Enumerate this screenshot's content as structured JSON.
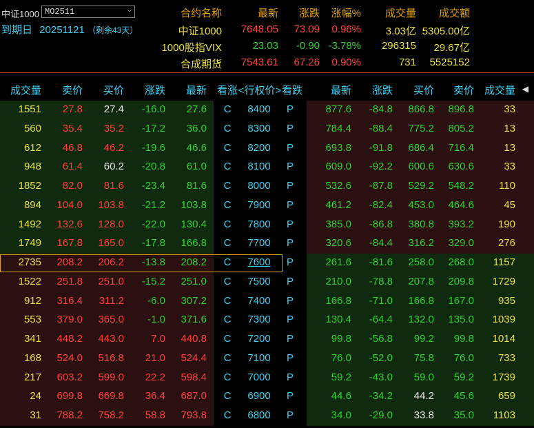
{
  "header": {
    "instrument_label": "中证1000",
    "contract_select": "MO2511",
    "expiry_label": "到期日",
    "expiry_date": "20251121",
    "expiry_remaining": "（剩余43天）",
    "columns": [
      "合约名称",
      "最新",
      "涨跌",
      "涨幅%",
      "成交量",
      "成交额"
    ],
    "indices": [
      {
        "name": "中证1000",
        "last": "7648.05",
        "chg": "73.09",
        "pct": "0.96%",
        "vol": "3.03亿",
        "amt": "5305.00亿"
      },
      {
        "name": "1000股指VIX",
        "last": "23.03",
        "chg": "-0.90",
        "pct": "-3.78%",
        "vol": "296315",
        "amt": "29.67亿"
      },
      {
        "name": "合成期货",
        "last": "7543.61",
        "chg": "67.26",
        "pct": "0.90%",
        "vol": "731",
        "amt": "5525152"
      }
    ]
  },
  "table": {
    "columns": [
      "成交量",
      "卖价",
      "买价",
      "涨跌",
      "最新",
      "看涨",
      "<行权价>",
      "看跌",
      "最新",
      "涨跌",
      "买价",
      "卖价",
      "成交量"
    ],
    "rows": [
      {
        "cv": "1551",
        "cs": "27.8",
        "cb": "27.4",
        "cc": "-16.0",
        "cl": "27.6",
        "k": "8400",
        "pl": "877.6",
        "pc": "-84.8",
        "pb": "866.8",
        "ps": "896.8",
        "pv": "33"
      },
      {
        "cv": "560",
        "cs": "35.4",
        "cb": "35.2",
        "cc": "-17.2",
        "cl": "36.0",
        "k": "8300",
        "pl": "784.4",
        "pc": "-88.4",
        "pb": "775.2",
        "ps": "805.2",
        "pv": "13"
      },
      {
        "cv": "612",
        "cs": "46.8",
        "cb": "46.2",
        "cc": "-19.6",
        "cl": "46.6",
        "k": "8200",
        "pl": "693.8",
        "pc": "-91.8",
        "pb": "686.4",
        "ps": "716.4",
        "pv": "13"
      },
      {
        "cv": "948",
        "cs": "61.4",
        "cb": "60.2",
        "cc": "-20.8",
        "cl": "61.0",
        "k": "8100",
        "pl": "609.0",
        "pc": "-92.2",
        "pb": "600.6",
        "ps": "630.6",
        "pv": "33"
      },
      {
        "cv": "1852",
        "cs": "82.0",
        "cb": "81.6",
        "cc": "-23.4",
        "cl": "81.6",
        "k": "8000",
        "pl": "532.6",
        "pc": "-87.8",
        "pb": "529.2",
        "ps": "548.2",
        "pv": "110"
      },
      {
        "cv": "894",
        "cs": "104.0",
        "cb": "103.8",
        "cc": "-21.2",
        "cl": "103.8",
        "k": "7900",
        "pl": "461.2",
        "pc": "-82.4",
        "pb": "453.0",
        "ps": "464.6",
        "pv": "45"
      },
      {
        "cv": "1492",
        "cs": "132.6",
        "cb": "128.0",
        "cc": "-22.0",
        "cl": "130.4",
        "k": "7800",
        "pl": "385.0",
        "pc": "-86.8",
        "pb": "380.8",
        "ps": "393.2",
        "pv": "190"
      },
      {
        "cv": "1749",
        "cs": "167.8",
        "cb": "165.0",
        "cc": "-17.8",
        "cl": "166.8",
        "k": "7700",
        "pl": "320.6",
        "pc": "-84.4",
        "pb": "316.2",
        "ps": "329.0",
        "pv": "276"
      },
      {
        "cv": "2735",
        "cs": "208.2",
        "cb": "206.2",
        "cc": "-13.8",
        "cl": "208.2",
        "k": "7600",
        "pl": "261.6",
        "pc": "-81.6",
        "pb": "258.0",
        "ps": "268.0",
        "pv": "1157"
      },
      {
        "cv": "1522",
        "cs": "251.8",
        "cb": "251.0",
        "cc": "-15.2",
        "cl": "251.0",
        "k": "7500",
        "pl": "210.0",
        "pc": "-78.8",
        "pb": "207.8",
        "ps": "209.8",
        "pv": "1729"
      },
      {
        "cv": "912",
        "cs": "316.4",
        "cb": "311.2",
        "cc": "-6.0",
        "cl": "307.2",
        "k": "7400",
        "pl": "166.8",
        "pc": "-71.0",
        "pb": "166.8",
        "ps": "167.0",
        "pv": "935"
      },
      {
        "cv": "553",
        "cs": "379.0",
        "cb": "365.0",
        "cc": "-1.0",
        "cl": "371.6",
        "k": "7300",
        "pl": "130.4",
        "pc": "-64.4",
        "pb": "132.0",
        "ps": "135.0",
        "pv": "1039"
      },
      {
        "cv": "341",
        "cs": "448.2",
        "cb": "443.0",
        "cc": "7.0",
        "cl": "440.8",
        "k": "7200",
        "pl": "99.8",
        "pc": "-56.8",
        "pb": "99.2",
        "ps": "99.8",
        "pv": "1014"
      },
      {
        "cv": "168",
        "cs": "524.0",
        "cb": "516.8",
        "cc": "21.0",
        "cl": "524.4",
        "k": "7100",
        "pl": "76.0",
        "pc": "-52.0",
        "pb": "75.8",
        "ps": "76.0",
        "pv": "733"
      },
      {
        "cv": "217",
        "cs": "603.2",
        "cb": "599.0",
        "cc": "22.2",
        "cl": "598.4",
        "k": "7000",
        "pl": "59.2",
        "pc": "-43.0",
        "pb": "59.0",
        "ps": "59.2",
        "pv": "1739"
      },
      {
        "cv": "24",
        "cs": "699.8",
        "cb": "669.8",
        "cc": "36.4",
        "cl": "687.0",
        "k": "6900",
        "pl": "44.6",
        "pc": "-34.2",
        "pb": "44.2",
        "ps": "45.6",
        "pv": "659"
      },
      {
        "cv": "31",
        "cs": "788.2",
        "cb": "758.2",
        "cc": "58.8",
        "cl": "793.8",
        "k": "6800",
        "pl": "34.0",
        "pc": "-29.0",
        "pb": "33.8",
        "ps": "35.0",
        "pv": "1103"
      }
    ],
    "call_marker": "C",
    "put_marker": "P",
    "atm_strike": "7600"
  },
  "colors": {
    "red": "#ff4040",
    "green": "#30d030",
    "yellow": "#e8e040",
    "white": "#e8e8e8",
    "cyan": "#3fd0f0",
    "orange": "#e0a000"
  }
}
